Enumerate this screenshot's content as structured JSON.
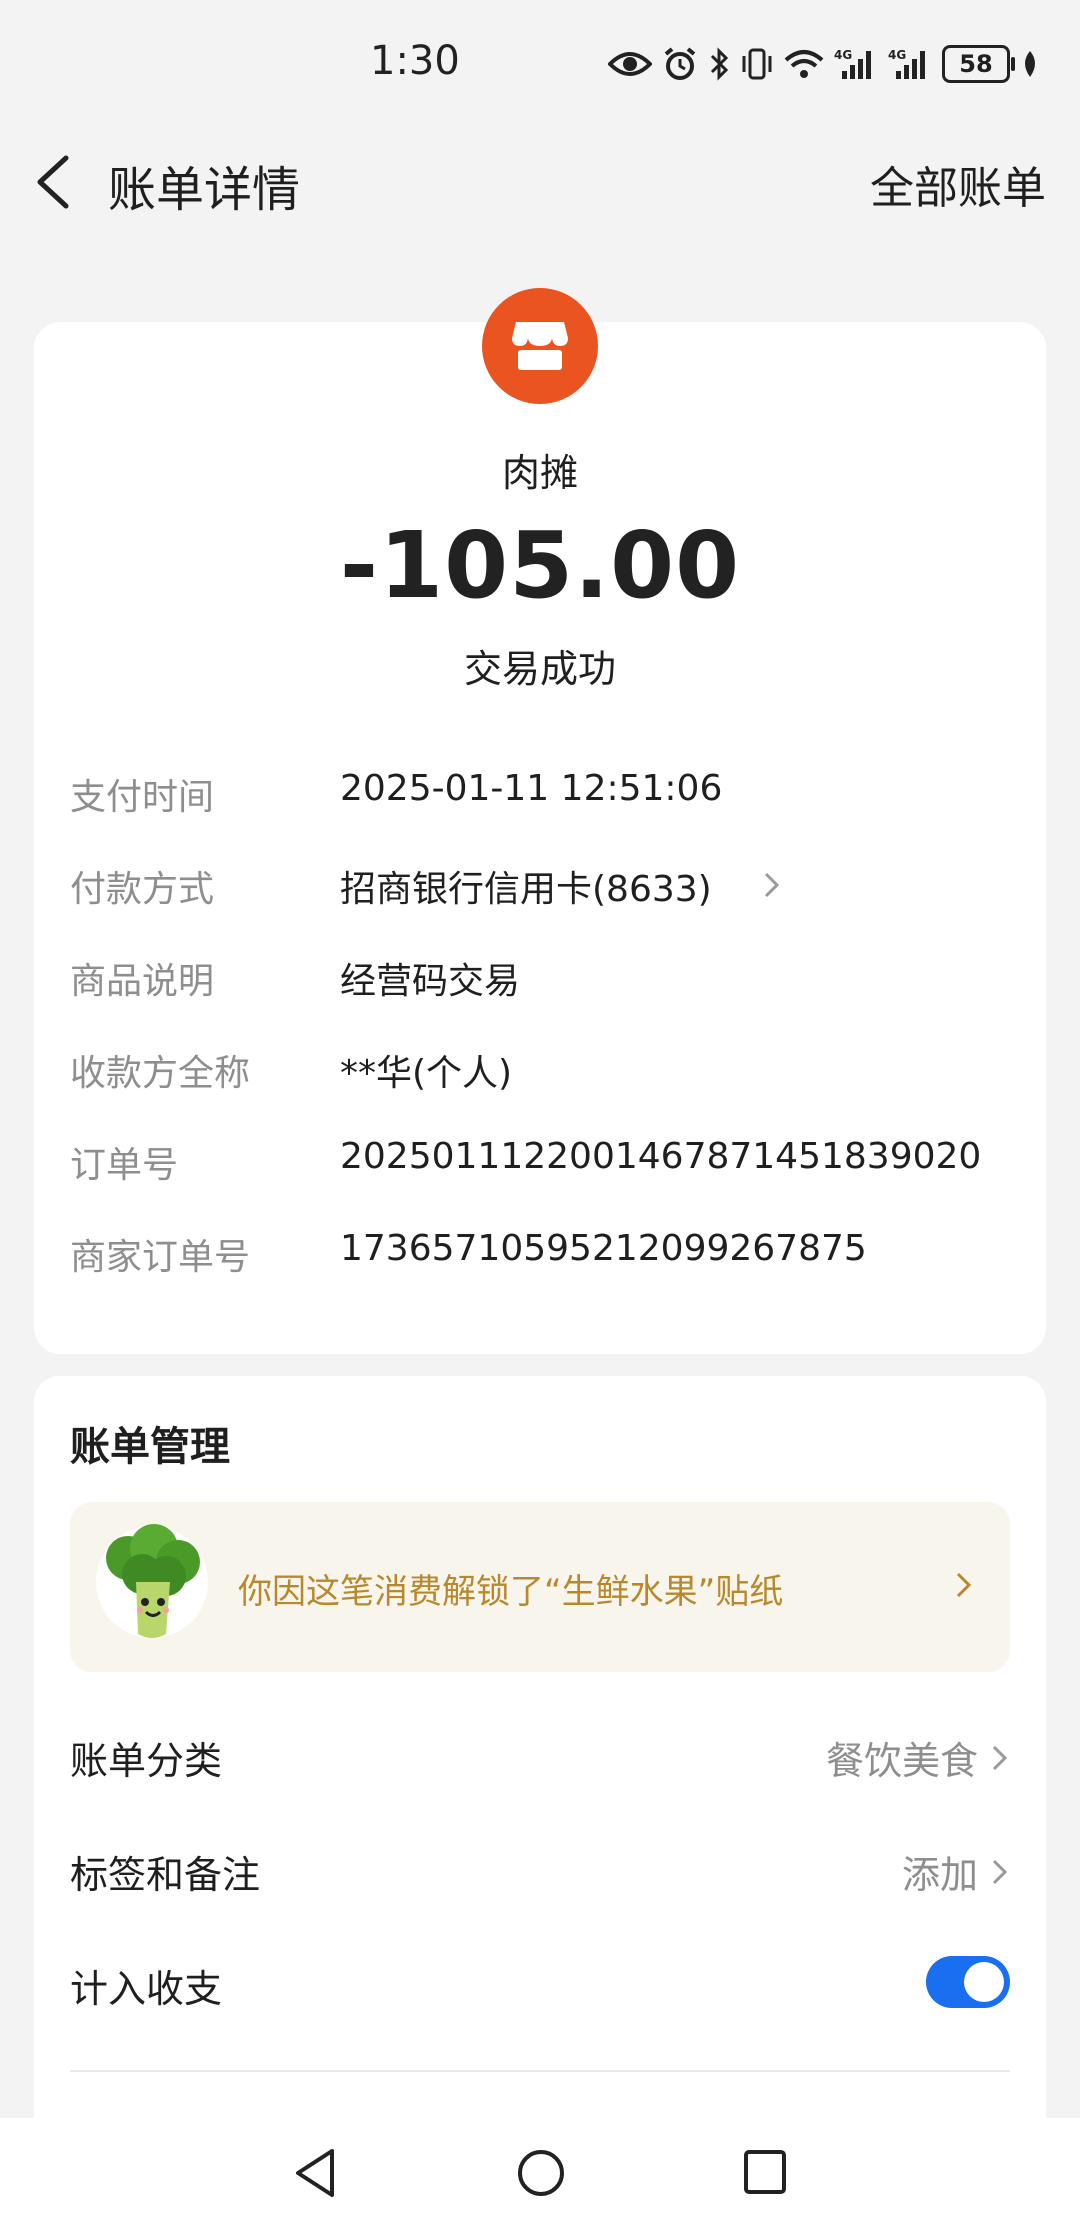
{
  "status_bar": {
    "time": "1:30",
    "battery": "58"
  },
  "header": {
    "title": "账单详情",
    "all_bills_label": "全部账单"
  },
  "transaction": {
    "merchant_name": "肉摊",
    "amount": "-105.00",
    "status": "交易成功",
    "logo_color": "#ea5420",
    "details": [
      {
        "label": "支付时间",
        "value": "2025-01-11 12:51:06"
      },
      {
        "label": "付款方式",
        "value": "招商银行信用卡(8633)"
      },
      {
        "label": "商品说明",
        "value": "经营码交易"
      },
      {
        "label": "收款方全称",
        "value": "**华(个人)"
      },
      {
        "label": "订单号",
        "value": "2025011122001467871451839020"
      },
      {
        "label": "商家订单号",
        "value": "1736571059521209926787​5"
      }
    ]
  },
  "bill_management": {
    "title": "账单管理",
    "sticker_banner": "你因这笔消费解锁了“生鲜水果”贴纸",
    "category": {
      "label": "账单分类",
      "value": "餐饮美食"
    },
    "tags": {
      "label": "标签和备注",
      "value": "添加"
    },
    "include_in_stats": {
      "label": "计入收支",
      "enabled": true
    },
    "accent_color": "#1a6ef0"
  }
}
